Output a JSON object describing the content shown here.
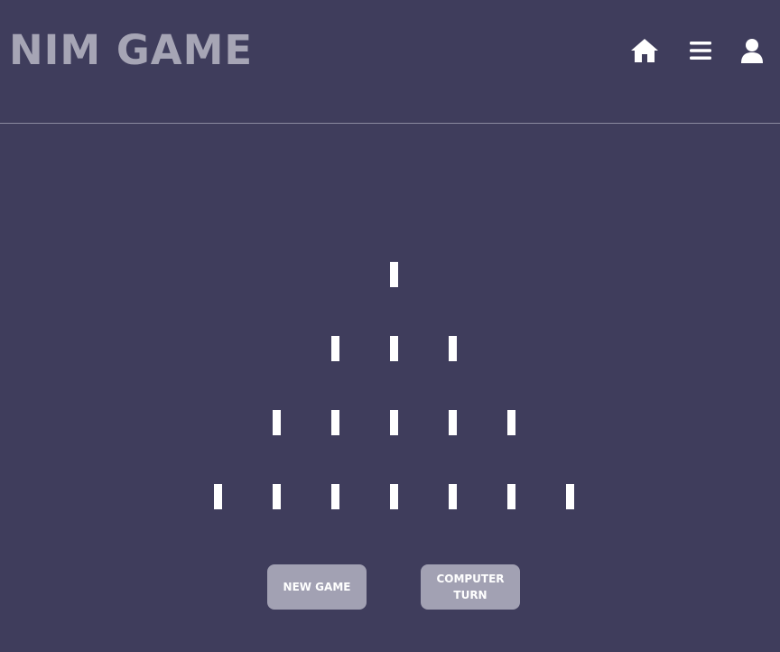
{
  "header": {
    "title": "NIM GAME",
    "icons": [
      "home-icon",
      "menu-icon",
      "user-icon"
    ]
  },
  "game": {
    "rows": [
      1,
      3,
      5,
      7
    ],
    "stick_color": "#ffffff"
  },
  "buttons": {
    "new_game": "NEW GAME",
    "computer_turn": "COMPUTER TURN"
  },
  "colors": {
    "background": "#3f3d5c",
    "title": "#a6a5b5",
    "button": "#a2a1b3"
  }
}
